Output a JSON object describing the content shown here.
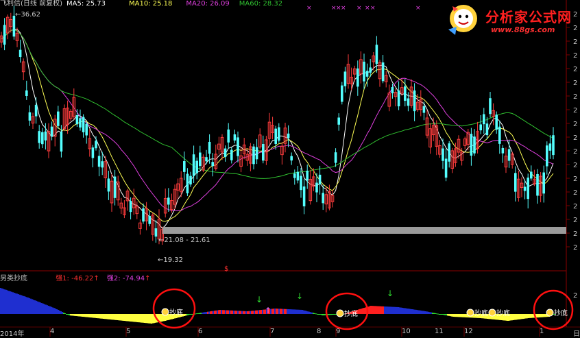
{
  "header": {
    "stock": "飞利信(日线 前复权)",
    "ma5": "MA5: 25.73",
    "ma10": "MA10: 25.18",
    "ma20": "MA20: 26.09",
    "ma60": "MA60: 28.32"
  },
  "indicator": {
    "name": "另类抄底",
    "q1": "强1: -46.22",
    "q2": "强2: -74.94",
    "mark_label": "抄底",
    "sub_tick": "2"
  },
  "annotations": {
    "high": "36.62",
    "low": "19.32",
    "range": "21.08 - 21.61",
    "dollar": "$"
  },
  "logo": {
    "name": "分析家公式网",
    "url": "www.88gs.com"
  },
  "x_axis": {
    "start": "2014年",
    "months": [
      "4",
      "5",
      "6",
      "7",
      "8",
      "9",
      "10",
      "11",
      "12",
      "1",
      "日"
    ]
  },
  "colors": {
    "up": "#ff3c3c",
    "down": "#54ffff",
    "ma5": "#ffffff",
    "ma10": "#ffff55",
    "ma20": "#e040e0",
    "ma60": "#30c030",
    "grid": "#8b0000",
    "sub_blue": "#1f2fd0",
    "sub_yellow": "#ffff40",
    "sub_green": "#30e030",
    "sub_red": "#ff2020"
  }
}
